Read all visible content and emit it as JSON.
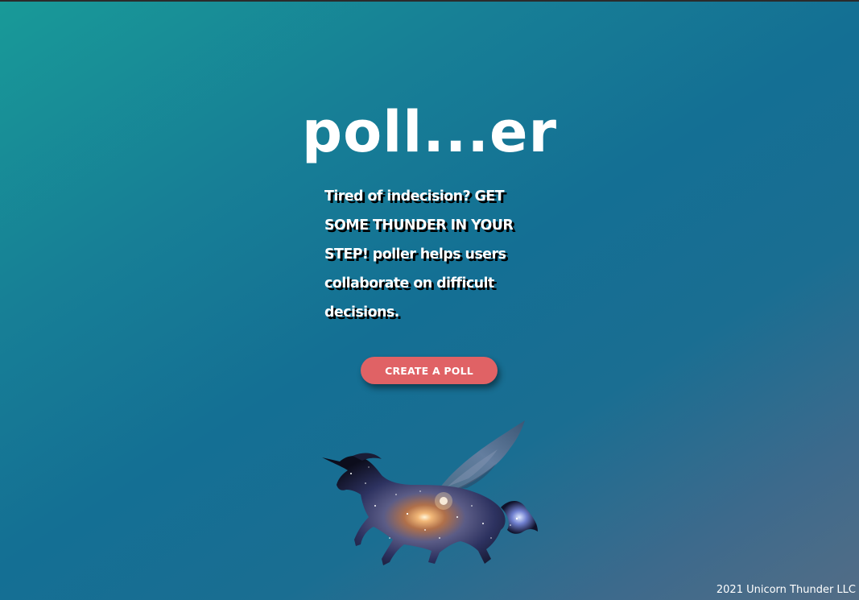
{
  "header": {
    "title": "poll...er"
  },
  "main": {
    "tagline": "Tired of indecision? GET SOME THUNDER IN YOUR STEP! poller helps users collaborate on difficult decisions.",
    "create_button_label": "CREATE A POLL",
    "mascot_icon": "winged-unicorn-galaxy-icon"
  },
  "footer": {
    "copyright": "2021 Unicorn Thunder LLC"
  },
  "colors": {
    "gradient_start": "#189a98",
    "gradient_mid": "#146f94",
    "gradient_end": "#536d86",
    "button": "#e06265",
    "text": "#ffffff"
  }
}
